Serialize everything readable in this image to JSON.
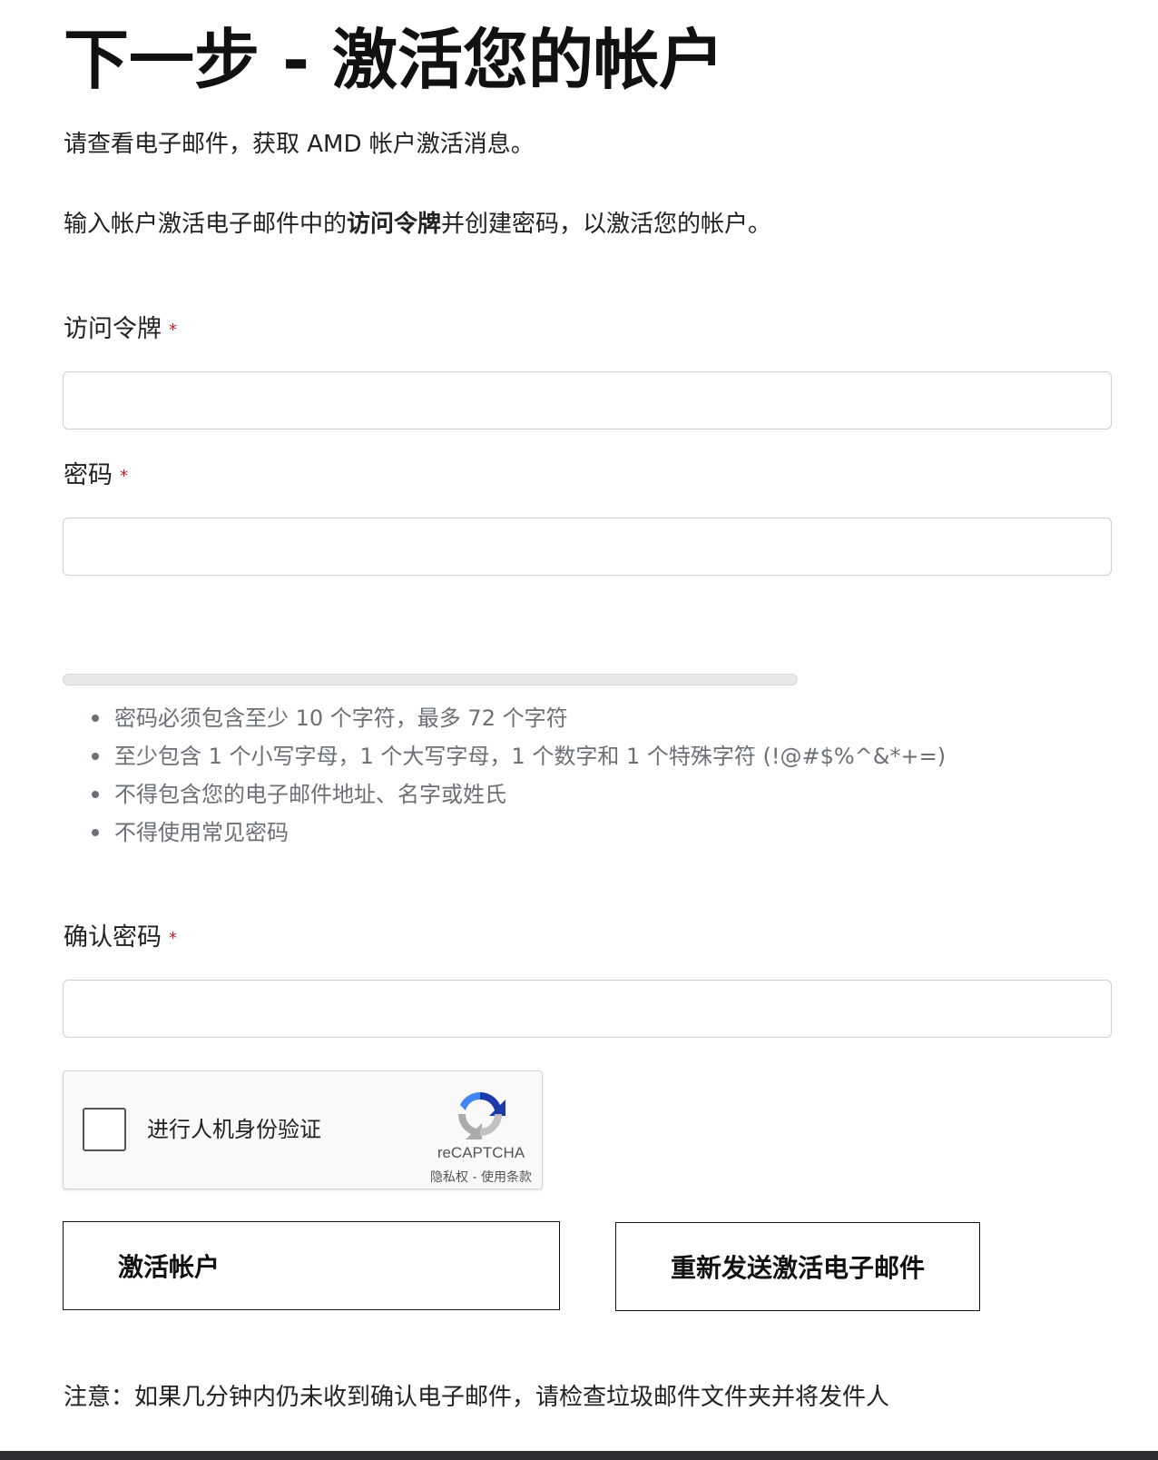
{
  "heading": "下一步 - 激活您的帐户",
  "intro": "请查看电子邮件，获取 AMD 帐户激活消息。",
  "instruction": {
    "before": "输入帐户激活电子邮件中的",
    "bold": "访问令牌",
    "after": "并创建密码，以激活您的帐户。"
  },
  "form": {
    "token_label": "访问令牌",
    "password_label": "密码",
    "confirm_label": "确认密码",
    "required_mark": "*",
    "token_value": "",
    "password_value": "",
    "confirm_value": ""
  },
  "password_strength": {
    "fraction": 0
  },
  "password_rules": [
    "密码必须包含至少 10 个字符，最多 72 个字符",
    "至少包含 1 个小写字母，1 个大写字母，1 个数字和 1 个特殊字符 (!@#$%^&*+=)",
    "不得包含您的电子邮件地址、名字或姓氏",
    "不得使用常见密码"
  ],
  "captcha": {
    "label": "进行人机身份验证",
    "brand": "reCAPTCHA",
    "privacy": "隐私权",
    "separator": " - ",
    "terms": "使用条款",
    "icon": "recaptcha-logo"
  },
  "buttons": {
    "activate": "激活帐户",
    "resend": "重新发送激活电子邮件"
  },
  "note": "注意：如果几分钟内仍未收到确认电子邮件，请检查垃圾邮件文件夹并将发件人",
  "colors": {
    "required": "#b3262d",
    "muted_text": "#6b7075",
    "field_border": "#cdd0d4"
  }
}
